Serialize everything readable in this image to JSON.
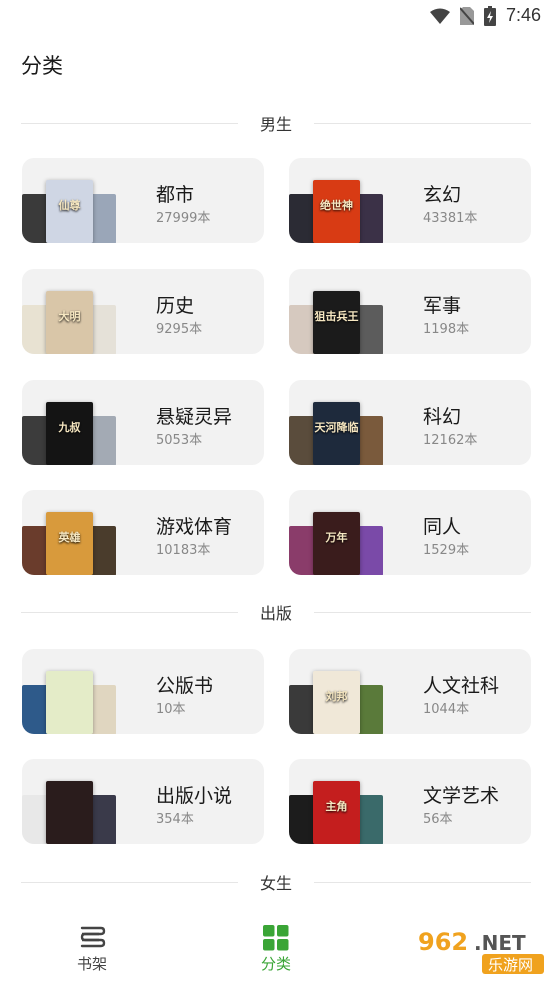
{
  "status_bar": {
    "time": "7:46"
  },
  "page": {
    "title": "分类"
  },
  "sections": {
    "male": "男生",
    "publish": "出版",
    "female": "女生"
  },
  "categories": [
    {
      "name": "都市",
      "count": "27999本",
      "colors": [
        "#3a3a3a",
        "#cfd6e4",
        "#9aa6b8"
      ],
      "cover_text": "仙尊"
    },
    {
      "name": "玄幻",
      "count": "43381本",
      "colors": [
        "#2b2b34",
        "#d83b14",
        "#3b3147"
      ],
      "cover_text": "绝世神"
    },
    {
      "name": "历史",
      "count": "9295本",
      "colors": [
        "#e8e2d2",
        "#d9c6a8",
        "#e5e1d8"
      ],
      "cover_text": "大明"
    },
    {
      "name": "军事",
      "count": "1198本",
      "colors": [
        "#d6c9bf",
        "#1b1b1b",
        "#5c5c5c"
      ],
      "cover_text": "狙击兵王"
    },
    {
      "name": "悬疑灵异",
      "count": "5053本",
      "colors": [
        "#3c3c3c",
        "#141414",
        "#a3aab4"
      ],
      "cover_text": "九叔"
    },
    {
      "name": "科幻",
      "count": "12162本",
      "colors": [
        "#5a4c3c",
        "#1e2a3c",
        "#7a5a3c"
      ],
      "cover_text": "天河降临"
    },
    {
      "name": "游戏体育",
      "count": "10183本",
      "colors": [
        "#6a3c2c",
        "#d89a3c",
        "#4a3c2c"
      ],
      "cover_text": "英雄"
    },
    {
      "name": "同人",
      "count": "1529本",
      "colors": [
        "#8a3c6a",
        "#3a1c1c",
        "#7a4aa8"
      ],
      "cover_text": "万年"
    },
    {
      "name": "公版书",
      "count": "10本",
      "colors": [
        "#2e5a8a",
        "#e4ecc8",
        "#e0d6c0"
      ],
      "cover_text": ""
    },
    {
      "name": "人文社科",
      "count": "1044本",
      "colors": [
        "#3a3a3a",
        "#f0e8d8",
        "#5a7a3a"
      ],
      "cover_text": "刘邦"
    },
    {
      "name": "出版小说",
      "count": "354本",
      "colors": [
        "#e8e8e8",
        "#2a1c1c",
        "#3a3a4a"
      ],
      "cover_text": ""
    },
    {
      "name": "文学艺术",
      "count": "56本",
      "colors": [
        "#1c1c1c",
        "#c41e1e",
        "#3a6a6a"
      ],
      "cover_text": "主角"
    }
  ],
  "bottom_nav": {
    "items": [
      {
        "label": "书架",
        "icon": "bookshelf-icon"
      },
      {
        "label": "分类",
        "icon": "grid-icon",
        "active": true
      }
    ],
    "active_color": "#3aa536"
  },
  "watermark": {
    "text": "962.NET",
    "sub": "乐游网"
  }
}
